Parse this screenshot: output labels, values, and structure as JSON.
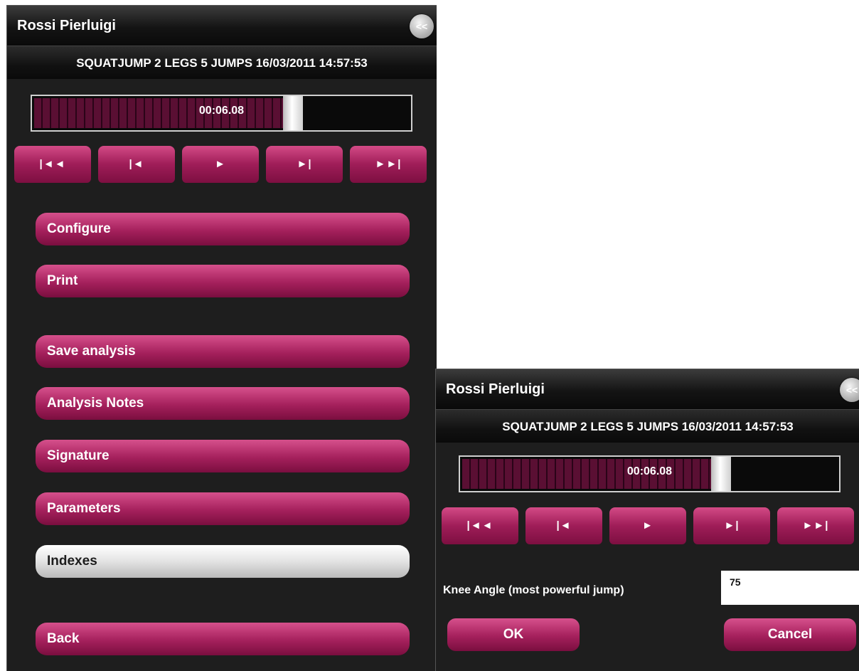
{
  "main_panel": {
    "title": "Rossi Pierluigi",
    "collapse_label": "<<",
    "session_title": "SQUATJUMP 2 LEGS 5 JUMPS 16/03/2011 14:57:53",
    "playback": {
      "time": "00:06.08",
      "progress": 0.69
    },
    "transport": {
      "first": "|◄◄",
      "prev": "|◄",
      "play": "►",
      "next": "►|",
      "last": "►►|"
    },
    "menu": [
      {
        "label": "Configure",
        "selected": false
      },
      {
        "label": "Print",
        "selected": false
      },
      {
        "label": "Save analysis",
        "selected": false
      },
      {
        "label": "Analysis Notes",
        "selected": false
      },
      {
        "label": "Signature",
        "selected": false
      },
      {
        "label": "Parameters",
        "selected": false
      },
      {
        "label": "Indexes",
        "selected": true
      },
      {
        "label": "Back",
        "selected": false
      }
    ]
  },
  "dialog_panel": {
    "title": "Rossi Pierluigi",
    "collapse_label": "<<",
    "session_title": "SQUATJUMP 2 LEGS 5 JUMPS 16/03/2011 14:57:53",
    "playback": {
      "time": "00:06.08",
      "progress": 0.69
    },
    "transport": {
      "first": "|◄◄",
      "prev": "|◄",
      "play": "►",
      "next": "►|",
      "last": "►►|"
    },
    "field_label": "Knee Angle (most powerful jump)",
    "field_value": "75",
    "ok_label": "OK",
    "cancel_label": "Cancel"
  },
  "colors": {
    "accent": "#a5205c",
    "selected": "#e3e3e3",
    "panel_bg": "#1e1e1e"
  }
}
